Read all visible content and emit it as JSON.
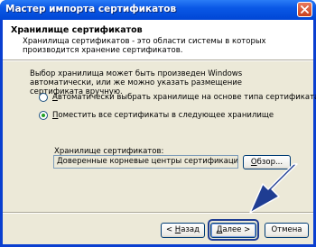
{
  "window": {
    "title": "Мастер импорта сертификатов"
  },
  "header": {
    "title": "Хранилище сертификатов",
    "description": "Хранилища сертификатов - это области системы в которых производится хранение сертификатов."
  },
  "body": {
    "intro": "Выбор хранилища может быть произведен Windows автоматически, или же можно указать размещение сертификата вручную.",
    "options": [
      {
        "label": "Автоматически выбрать хранилище на основе типа сертификата",
        "selected": false,
        "mnemonic": "А"
      },
      {
        "label": "Поместить все сертификаты в следующее хранилище",
        "selected": true,
        "mnemonic": "П"
      }
    ],
    "store_label": "Хранилище сертификатов:",
    "store_value": "Доверенные корневые центры сертификации",
    "browse_label": "Обзор..."
  },
  "footer": {
    "back_label": "< Назад",
    "next_label": "Далее >",
    "cancel_label": "Отмена"
  },
  "colors": {
    "title_bar": "#0a58e6",
    "dialog_bg": "#ece9d8",
    "highlight": "#1f3d92",
    "arrow": "#1f3d92"
  }
}
